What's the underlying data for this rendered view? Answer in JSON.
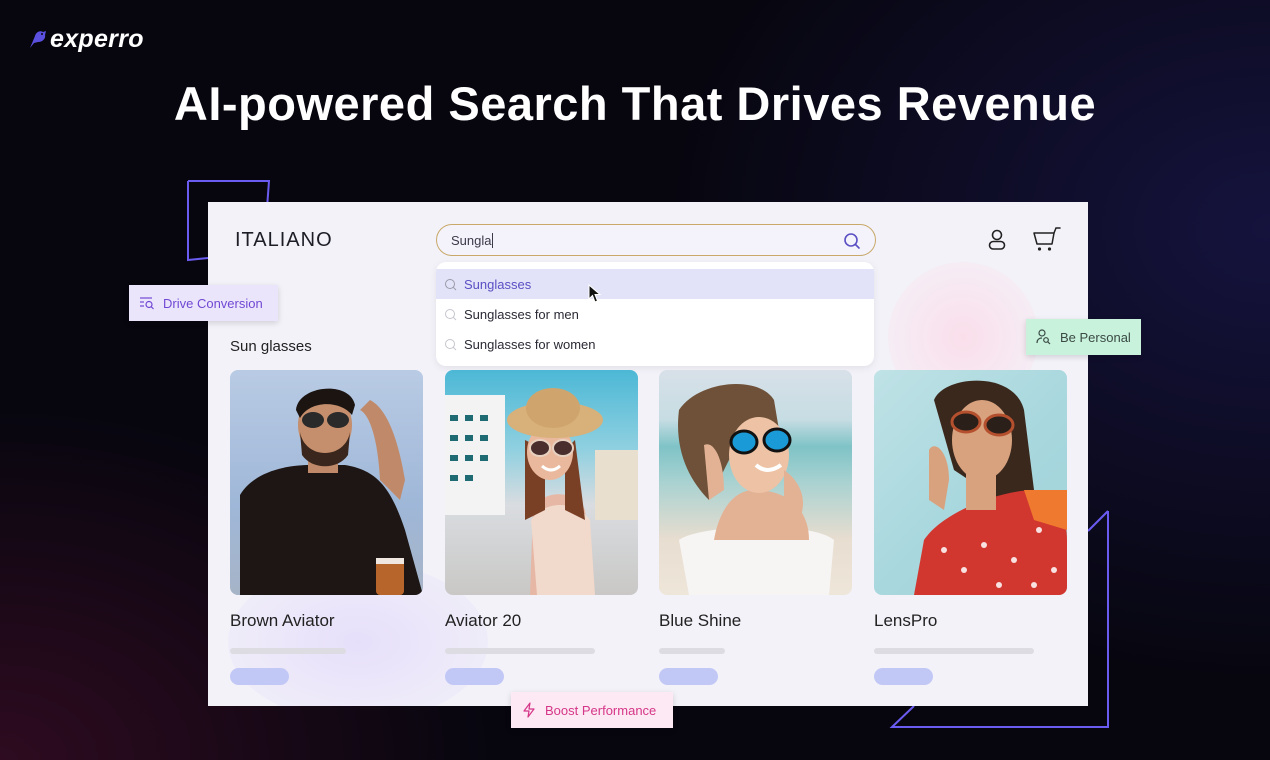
{
  "logo": {
    "text": "experro",
    "icon": "bird-logo-icon",
    "accent": "#5b4fe0"
  },
  "headline": "AI-powered Search That Drives Revenue",
  "store": {
    "brand": "ITALIANO",
    "search": {
      "value": "Sungla",
      "icon": "search-icon"
    },
    "suggestions": [
      {
        "label": "Sunglasses",
        "active": true
      },
      {
        "label": "Sunglasses for men",
        "active": false
      },
      {
        "label": "Sunglasses for women",
        "active": false
      }
    ],
    "header_icons": [
      "user-icon",
      "cart-icon"
    ],
    "section_title": "Sun glasses",
    "products": [
      {
        "name": "Brown Aviator"
      },
      {
        "name": "Aviator 20"
      },
      {
        "name": "Blue Shine"
      },
      {
        "name": "LensPro"
      }
    ]
  },
  "chips": {
    "conversion": {
      "label": "Drive Conversion",
      "icon": "search-list-icon",
      "color": "#7148d3"
    },
    "personal": {
      "label": "Be Personal",
      "icon": "user-search-icon",
      "color": "#3a4a45"
    },
    "boost": {
      "label": "Boost Performance",
      "icon": "lightning-icon",
      "color": "#d53687"
    }
  }
}
